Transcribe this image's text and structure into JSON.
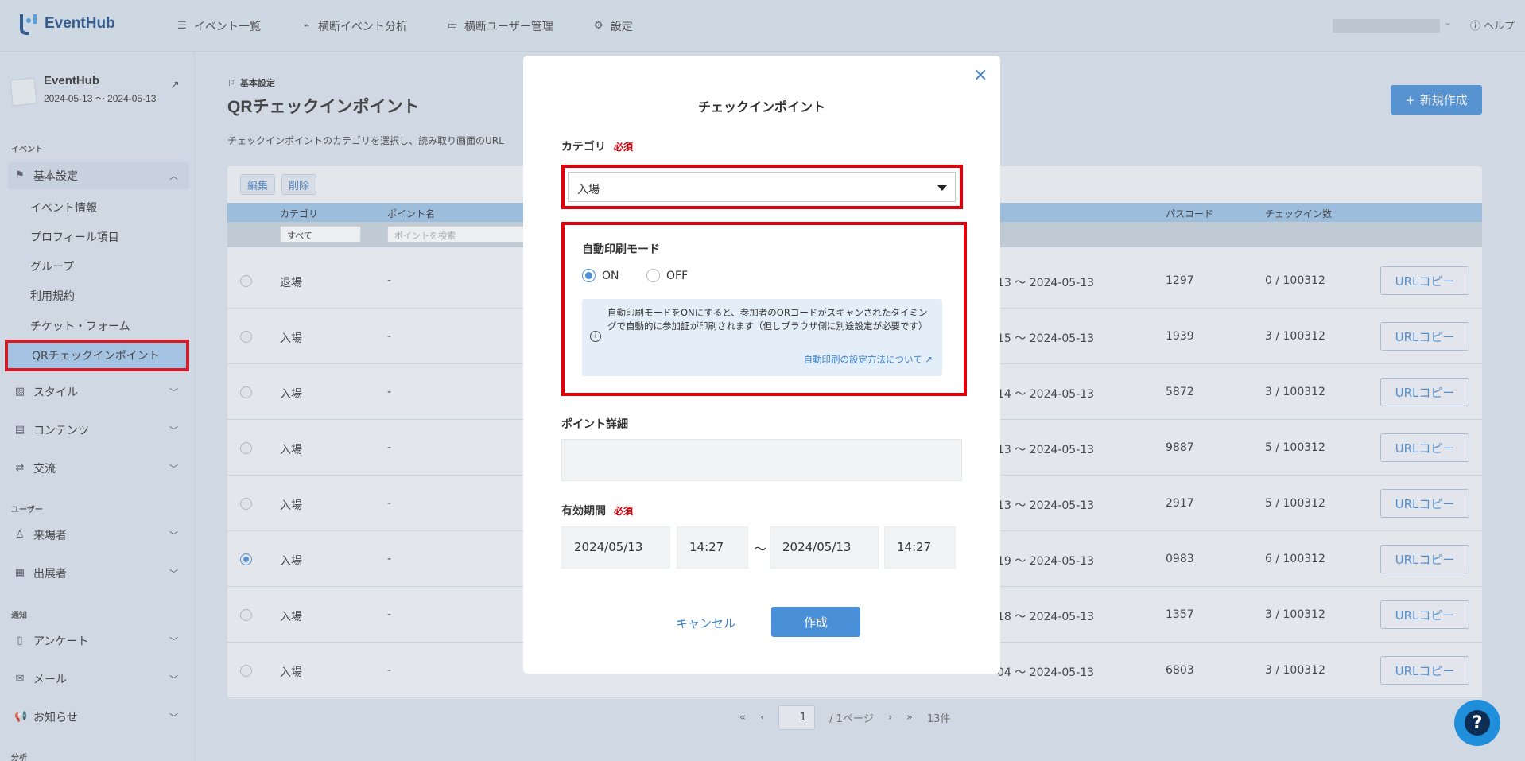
{
  "app": {
    "logo_text": "EventHub"
  },
  "topnav": {
    "items": [
      {
        "label": "イベント一覧",
        "icon": "list-icon"
      },
      {
        "label": "横断イベント分析",
        "icon": "chart-icon"
      },
      {
        "label": "横断ユーザー管理",
        "icon": "id-card-icon"
      },
      {
        "label": "設定",
        "icon": "gear-icon"
      }
    ],
    "help_label": "ヘルプ"
  },
  "sidebar": {
    "event_name": "EventHub",
    "event_dates": "2024-05-13 〜 2024-05-13",
    "sections": {
      "event": "イベント",
      "user": "ユーザー",
      "notice": "通知",
      "analysis": "分析"
    },
    "basic_settings": "基本設定",
    "sub_items": [
      "イベント情報",
      "プロフィール項目",
      "グループ",
      "利用規約",
      "チケット・フォーム",
      "QRチェックインポイント"
    ],
    "main_items": [
      "スタイル",
      "コンテンツ",
      "交流"
    ],
    "user_items": [
      "来場者",
      "出展者"
    ],
    "notice_items": [
      "アンケート",
      "メール",
      "お知らせ"
    ]
  },
  "page": {
    "breadcrumb": "基本設定",
    "title": "QRチェックインポイント",
    "description": "チェックインポイントのカテゴリを選択し、読み取り画面のURL",
    "new_button": "新規作成"
  },
  "table": {
    "toolbar": {
      "edit": "編集",
      "delete": "削除"
    },
    "headers": {
      "category": "カテゴリ",
      "point_name": "ポイント名",
      "passcode": "パスコード",
      "checkins": "チェックイン数"
    },
    "filters": {
      "category_value": "すべて",
      "point_placeholder": "ポイントを検索"
    },
    "copy_label": "URLコピー",
    "rows": [
      {
        "category": "退場",
        "name": "-",
        "period": "13 〜 2024-05-13",
        "passcode": "1297",
        "checkins": "0 / 100312",
        "selected": false
      },
      {
        "category": "入場",
        "name": "-",
        "period": "15 〜 2024-05-13",
        "passcode": "1939",
        "checkins": "3 / 100312",
        "selected": false
      },
      {
        "category": "入場",
        "name": "-",
        "period": "14 〜 2024-05-13",
        "passcode": "5872",
        "checkins": "3 / 100312",
        "selected": false
      },
      {
        "category": "入場",
        "name": "-",
        "period": "13 〜 2024-05-13",
        "passcode": "9887",
        "checkins": "5 / 100312",
        "selected": false
      },
      {
        "category": "入場",
        "name": "-",
        "period": "13 〜 2024-05-13",
        "passcode": "2917",
        "checkins": "5 / 100312",
        "selected": false
      },
      {
        "category": "入場",
        "name": "-",
        "period": "19 〜 2024-05-13",
        "passcode": "0983",
        "checkins": "6 / 100312",
        "selected": true
      },
      {
        "category": "入場",
        "name": "-",
        "period": "18 〜 2024-05-13",
        "passcode": "1357",
        "checkins": "3 / 100312",
        "selected": false
      },
      {
        "category": "入場",
        "name": "-",
        "period": "04 〜 2024-05-13",
        "passcode": "6803",
        "checkins": "3 / 100312",
        "selected": false
      }
    ]
  },
  "pager": {
    "page": "1",
    "total_pages": "/ 1ページ",
    "count": "13件"
  },
  "modal": {
    "title": "チェックインポイント",
    "category_label": "カテゴリ",
    "required": "必須",
    "category_value": "入場",
    "auto_print_label": "自動印刷モード",
    "on_label": "ON",
    "off_label": "OFF",
    "auto_print_value": "ON",
    "info_text": "自動印刷モードをONにすると、参加者のQRコードがスキャンされたタイミングで自動的に参加証が印刷されます（但しブラウザ側に別途設定が必要です）",
    "info_link": "自動印刷の設定方法について",
    "detail_label": "ポイント詳細",
    "period_label": "有効期間",
    "start_date": "2024/05/13",
    "start_time": "14:27",
    "tilde": "〜",
    "end_date": "2024/05/13",
    "end_time": "14:27",
    "cancel": "キャンセル",
    "create": "作成"
  },
  "colors": {
    "accent": "#4a90d8",
    "highlight": "#e0000b",
    "active_bg": "#a8cbee"
  }
}
